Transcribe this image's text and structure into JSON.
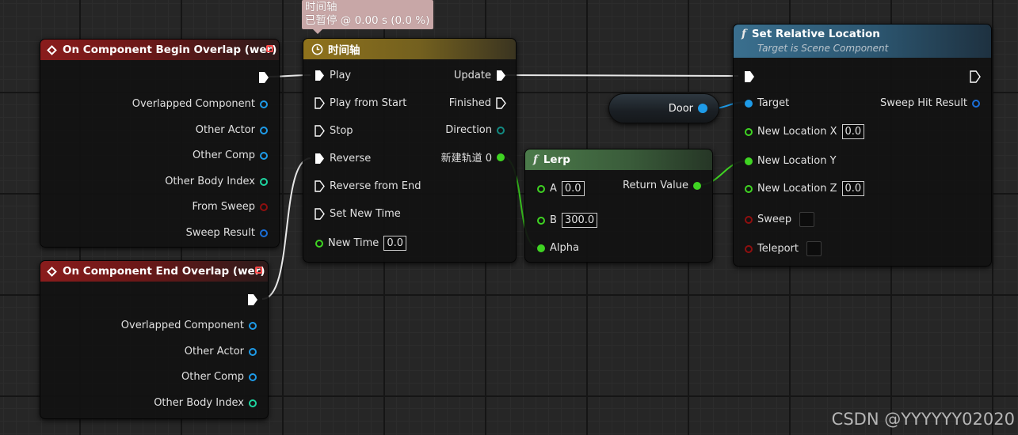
{
  "colors": {
    "exec": "#ffffff",
    "object": "#1e9be8",
    "int": "#1ed6a1",
    "bool": "#8f0f0f",
    "struct": "#1a6ed8",
    "float": "#3fd422",
    "vector": "#f5c84b"
  },
  "tooltip": {
    "line1": "时间轴",
    "line2": "已暂停 @ 0.00 s (0.0 %)"
  },
  "begin_overlap": {
    "title": "On Component Begin Overlap (wer)",
    "pins": [
      "Overlapped Component",
      "Other Actor",
      "Other Comp",
      "Other Body Index",
      "From Sweep",
      "Sweep Result"
    ]
  },
  "end_overlap": {
    "title": "On Component End Overlap (wer)",
    "pins": [
      "Overlapped Component",
      "Other Actor",
      "Other Comp",
      "Other Body Index"
    ]
  },
  "timeline": {
    "title": "时间轴",
    "inputs": [
      "Play",
      "Play from Start",
      "Stop",
      "Reverse",
      "Reverse from End",
      "Set New Time"
    ],
    "new_time_label": "New Time",
    "new_time_value": "0.0",
    "outputs": [
      "Update",
      "Finished",
      "Direction",
      "新建轨道 0"
    ]
  },
  "lerp": {
    "title": "Lerp",
    "a_label": "A",
    "a_value": "0.0",
    "b_label": "B",
    "b_value": "300.0",
    "alpha_label": "Alpha",
    "return_label": "Return Value"
  },
  "door": {
    "label": "Door"
  },
  "set_location": {
    "title": "Set Relative Location",
    "subtitle": "Target is Scene Component",
    "target_label": "Target",
    "sweep_hit_label": "Sweep Hit Result",
    "x_label": "New Location X",
    "x_value": "0.0",
    "y_label": "New Location Y",
    "z_label": "New Location Z",
    "z_value": "0.0",
    "sweep_label": "Sweep",
    "teleport_label": "Teleport"
  },
  "watermark": "CSDN @YYYYYY02020"
}
